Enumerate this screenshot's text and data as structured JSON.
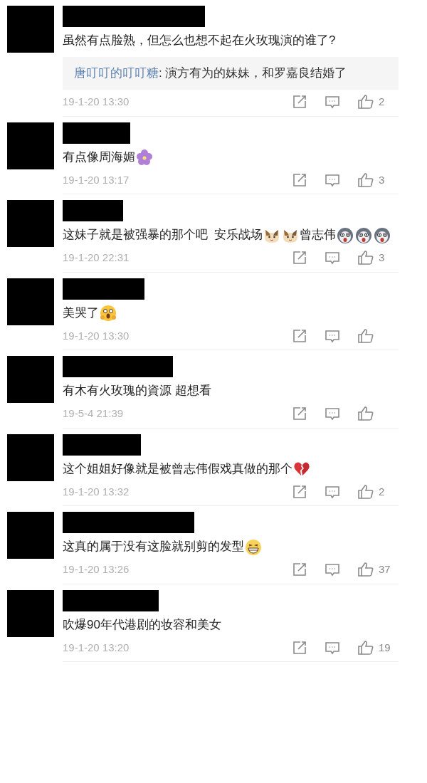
{
  "comments": [
    {
      "parts": [
        {
          "kind": "text",
          "text": "虽然有点脸熟，但怎么也想不起在火玫瑰演的谁了?"
        }
      ],
      "reply": {
        "author": "唐叮叮的叮叮糖",
        "text": ": 演方有为的妹妹，和罗嘉良结婚了"
      },
      "time": "19-1-20 13:30",
      "likes": "2"
    },
    {
      "parts": [
        {
          "kind": "text",
          "text": "有点像周海媚"
        },
        {
          "kind": "flower"
        }
      ],
      "time": "19-1-20 13:17",
      "likes": "3"
    },
    {
      "parts": [
        {
          "kind": "text",
          "text": "这妹子就是被强暴的那个吧  安乐战场"
        },
        {
          "kind": "cat"
        },
        {
          "kind": "cat"
        },
        {
          "kind": "text",
          "text": "曾志伟"
        },
        {
          "kind": "dog"
        },
        {
          "kind": "dog"
        },
        {
          "kind": "dog"
        }
      ],
      "time": "19-1-20 22:31",
      "likes": "3"
    },
    {
      "parts": [
        {
          "kind": "text",
          "text": "美哭了"
        },
        {
          "kind": "scared"
        }
      ],
      "time": "19-1-20 13:30"
    },
    {
      "parts": [
        {
          "kind": "text",
          "text": "有木有火玫瑰的資源 超想看"
        }
      ],
      "time": "19-5-4 21:39"
    },
    {
      "parts": [
        {
          "kind": "text",
          "text": "这个姐姐好像就是被曾志伟假戏真做的那个"
        },
        {
          "kind": "heartbreak"
        }
      ],
      "time": "19-1-20 13:32",
      "likes": "2"
    },
    {
      "parts": [
        {
          "kind": "text",
          "text": "这真的属于没有这脸就别剪的发型"
        },
        {
          "kind": "grin"
        }
      ],
      "time": "19-1-20 13:26",
      "likes": "37"
    },
    {
      "parts": [
        {
          "kind": "text",
          "text": "吹爆90年代港剧的妆容和美女"
        }
      ],
      "time": "19-1-20 13:20",
      "likes": "19"
    }
  ]
}
